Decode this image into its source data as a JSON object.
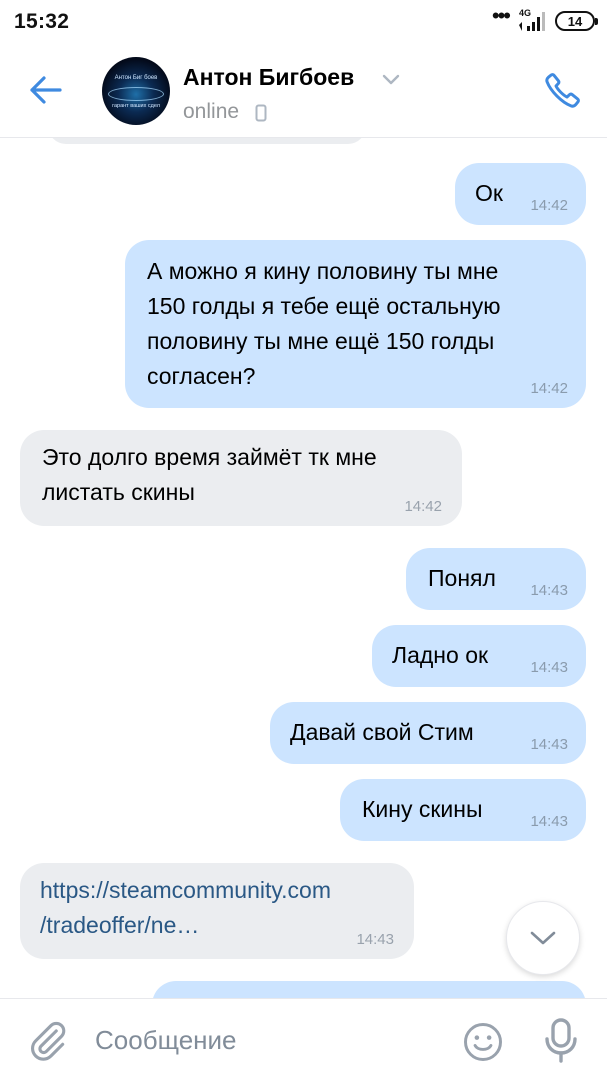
{
  "status_bar": {
    "time": "15:32",
    "network": "4G",
    "battery": "14"
  },
  "header": {
    "name": "Антон Бигбоев",
    "status": "online",
    "avatar_line1": "Антон Биг боев",
    "avatar_line2": "гарант ваших сдел"
  },
  "messages": [
    {
      "text_lines": [
        "Ок"
      ],
      "time": "14:42"
    },
    {
      "text_lines": [
        "А можно я кину половину ты мне",
        "150 голды я тебе ещё остальную",
        "половину ты мне ещё 150 голды",
        "согласен?"
      ],
      "time": "14:42"
    },
    {
      "text_lines": [
        "Это долго время займёт тк мне",
        "листать скины"
      ],
      "time": "14:42"
    },
    {
      "text_lines": [
        "Понял"
      ],
      "time": "14:43"
    },
    {
      "text_lines": [
        "Ладно ок"
      ],
      "time": "14:43"
    },
    {
      "text_lines": [
        "Давай свой Стим"
      ],
      "time": "14:43"
    },
    {
      "text_lines": [
        "Кину скины"
      ],
      "time": "14:43"
    },
    {
      "text_lines": [
        "https://steamcommunity.com",
        "/tradeoffer/ne…"
      ],
      "time": "14:43"
    }
  ],
  "composer": {
    "placeholder": "Сообщение"
  },
  "colors": {
    "accent": "#3f8ae0",
    "outgoing_bubble": "#cce4ff",
    "incoming_bubble": "#ebedf0",
    "link": "#2a5885"
  }
}
